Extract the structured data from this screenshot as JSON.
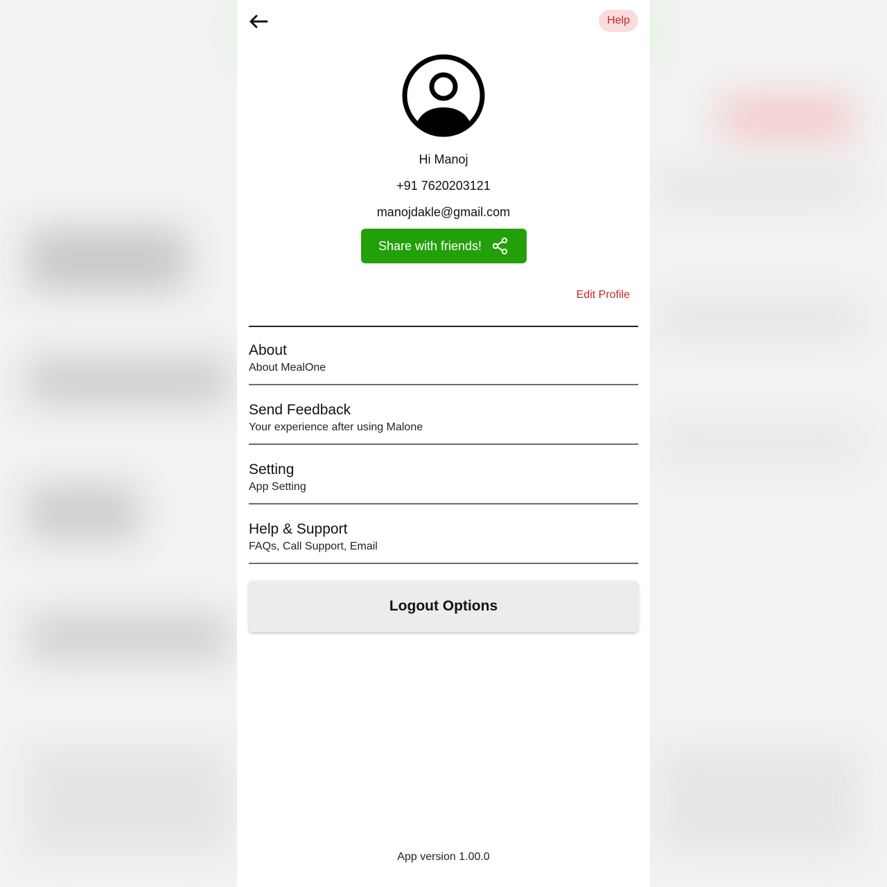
{
  "header": {
    "back_icon": "arrow-left-icon",
    "help_label": "Help"
  },
  "profile": {
    "avatar_icon": "user-circle-icon",
    "greeting": "Hi Manoj",
    "phone": "+91 7620203121",
    "email": "manojdakle@gmail.com",
    "share_label": "Share with friends!",
    "share_icon": "share-icon",
    "edit_label": "Edit Profile"
  },
  "menu": [
    {
      "title": "About",
      "subtitle": "About MealOne"
    },
    {
      "title": "Send Feedback",
      "subtitle": "Your experience after using Malone"
    },
    {
      "title": "Setting",
      "subtitle": "App Setting"
    },
    {
      "title": "Help & Support",
      "subtitle": "FAQs, Call Support, Email"
    }
  ],
  "logout_label": "Logout Options",
  "version_text": "App version 1.00.0",
  "colors": {
    "primary_green": "#22a00a",
    "accent_red": "#c62828",
    "help_bg": "#fbdcdc",
    "logout_bg": "#ececec"
  }
}
